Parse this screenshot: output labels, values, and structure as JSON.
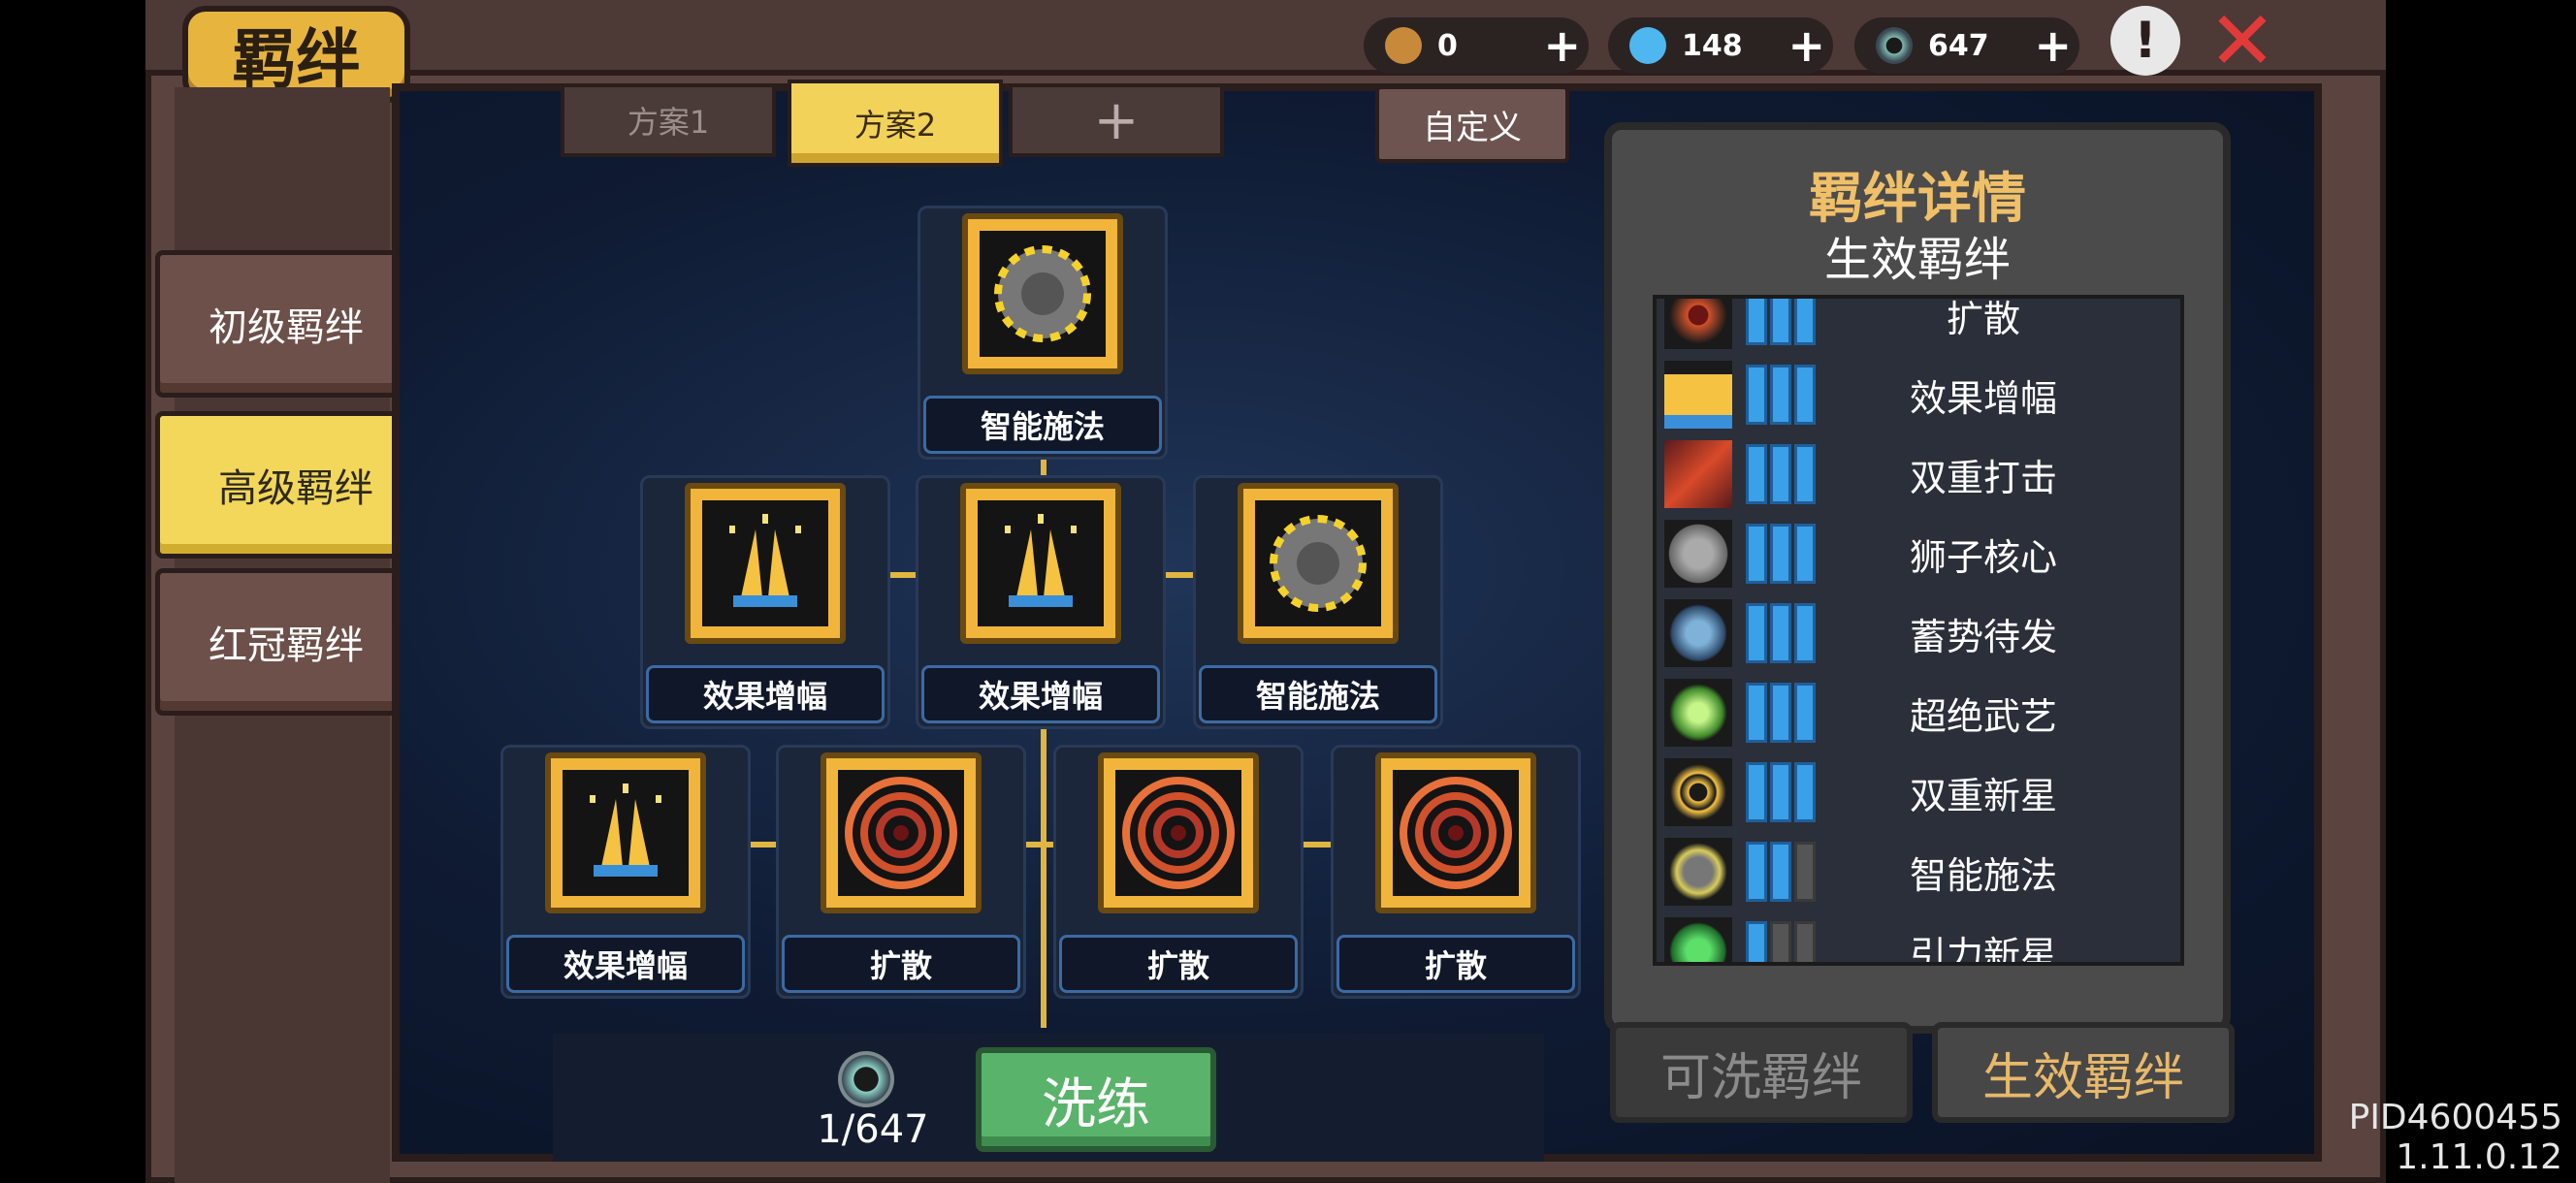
{
  "title": "羁绊",
  "currencies": [
    {
      "name": "bottle-icon",
      "value": "0",
      "color": "#c88a3a"
    },
    {
      "name": "gem-icon",
      "value": "148",
      "color": "#4fb7ef"
    },
    {
      "name": "orb-icon",
      "value": "647",
      "color": "#7fb8aa"
    }
  ],
  "plus": "+",
  "alert": "!",
  "close": "✕",
  "nav": [
    "初级羁绊",
    "高级羁绊",
    "红冠羁绊"
  ],
  "tabs": [
    "方案1",
    "方案2",
    "+"
  ],
  "custom": "自定义",
  "tree": {
    "row1": [
      "智能施法"
    ],
    "row2": [
      "效果增幅",
      "效果增幅",
      "智能施法"
    ],
    "row3": [
      "效果增幅",
      "扩散",
      "扩散",
      "扩散"
    ]
  },
  "cost": "1/647",
  "reroll": "洗练",
  "detail": {
    "title": "羁绊详情",
    "subtitle": "生效羁绊",
    "items": [
      {
        "name": "扩散",
        "level": 3
      },
      {
        "name": "效果增幅",
        "level": 3
      },
      {
        "name": "双重打击",
        "level": 3
      },
      {
        "name": "狮子核心",
        "level": 3
      },
      {
        "name": "蓄势待发",
        "level": 3
      },
      {
        "name": "超绝武艺",
        "level": 3
      },
      {
        "name": "双重新星",
        "level": 3
      },
      {
        "name": "智能施法",
        "level": 2
      },
      {
        "name": "引力新星",
        "level": 1
      }
    ],
    "tab_available": "可洗羁绊",
    "tab_active": "生效羁绊"
  },
  "version": "PID4600455 1.11.0.12",
  "colors": {
    "accent": "#f2d75a",
    "brown": "#5b4440",
    "blue": "#3aa0e8"
  }
}
